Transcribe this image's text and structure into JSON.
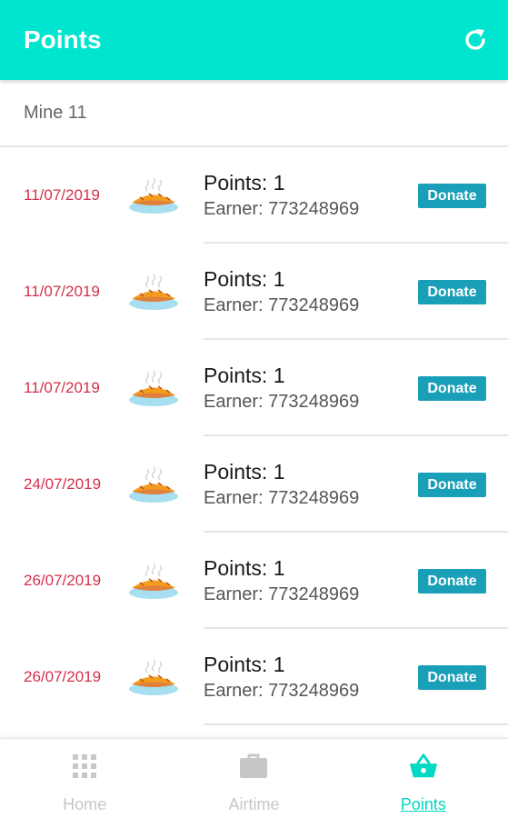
{
  "app_bar": {
    "title": "Points",
    "refresh_icon": "refresh-icon",
    "background_color": "#00e5cf"
  },
  "subheader": {
    "text": "Mine 11"
  },
  "items": [
    {
      "date": "11/07/2019",
      "points": "Points: 1",
      "earner": "Earner: 773248969",
      "button": "Donate",
      "icon": "pie-icon"
    },
    {
      "date": "11/07/2019",
      "points": "Points: 1",
      "earner": "Earner: 773248969",
      "button": "Donate",
      "icon": "pie-icon"
    },
    {
      "date": "11/07/2019",
      "points": "Points: 1",
      "earner": "Earner: 773248969",
      "button": "Donate",
      "icon": "pie-icon"
    },
    {
      "date": "24/07/2019",
      "points": "Points: 1",
      "earner": "Earner: 773248969",
      "button": "Donate",
      "icon": "pie-icon"
    },
    {
      "date": "26/07/2019",
      "points": "Points: 1",
      "earner": "Earner: 773248969",
      "button": "Donate",
      "icon": "pie-icon"
    },
    {
      "date": "26/07/2019",
      "points": "Points: 1",
      "earner": "Earner: 773248969",
      "button": "Donate",
      "icon": "pie-icon"
    }
  ],
  "bottom_nav": {
    "items": [
      {
        "label": "Home",
        "icon": "grid-icon",
        "active": false
      },
      {
        "label": "Airtime",
        "icon": "briefcase-icon",
        "active": false
      },
      {
        "label": "Points",
        "icon": "basket-icon",
        "active": true
      }
    ],
    "active_color": "#00d9c3",
    "inactive_color": "#c7c7c7"
  },
  "colors": {
    "date_text": "#d4304a",
    "donate_button": "#1a9fb8"
  }
}
